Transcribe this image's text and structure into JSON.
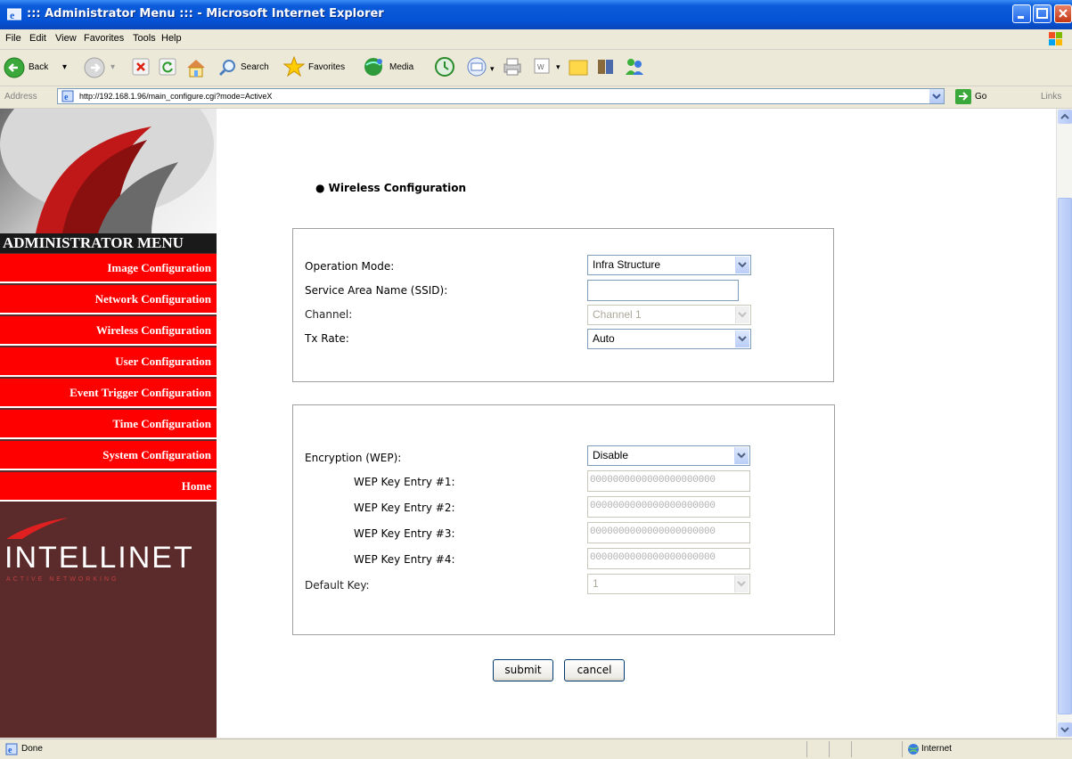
{
  "window": {
    "title": "::: Administrator Menu ::: - Microsoft Internet Explorer",
    "icon": "ie-icon"
  },
  "menubar": {
    "items": [
      "File",
      "Edit",
      "View",
      "Favorites",
      "Tools",
      "Help"
    ]
  },
  "toolbar": {
    "back_label": "Back",
    "search_label": "Search",
    "favorites_label": "Favorites",
    "media_label": "Media"
  },
  "addressbar": {
    "label": "Address",
    "url": "http://192.168.1.96/main_configure.cgi?mode=ActiveX",
    "go_label": "Go",
    "links_label": "Links"
  },
  "sidebar": {
    "header": "ADMINISTRATOR MENU",
    "items": [
      {
        "label": "Image Configuration"
      },
      {
        "label": "Network Configuration"
      },
      {
        "label": "Wireless Configuration"
      },
      {
        "label": "User Configuration"
      },
      {
        "label": "Event Trigger Configuration"
      },
      {
        "label": "Time Configuration"
      },
      {
        "label": "System Configuration"
      },
      {
        "label": "Home"
      }
    ],
    "logo_word": "INTELLINET",
    "logo_tagline": "ACTIVE NETWORKING"
  },
  "main": {
    "section_title": "Wireless Configuration",
    "wireless": {
      "operation_mode_label": "Operation Mode:",
      "operation_mode_value": "Infra Structure",
      "ssid_label": "Service Area Name (SSID):",
      "ssid_value": "",
      "channel_label": "Channel:",
      "channel_value": "Channel 1",
      "tx_rate_label": "Tx Rate:",
      "tx_rate_value": "Auto"
    },
    "encryption": {
      "wep_label": "Encryption (WEP):",
      "wep_value": "Disable",
      "keys": [
        {
          "label": "WEP Key Entry #1:",
          "value": "0000000000000000000000"
        },
        {
          "label": "WEP Key Entry #2:",
          "value": "0000000000000000000000"
        },
        {
          "label": "WEP Key Entry #3:",
          "value": "0000000000000000000000"
        },
        {
          "label": "WEP Key Entry #4:",
          "value": "0000000000000000000000"
        }
      ],
      "default_key_label": "Default Key:",
      "default_key_value": "1"
    },
    "submit_label": "submit",
    "cancel_label": "cancel"
  },
  "statusbar": {
    "status": "Done",
    "zone": "Internet"
  },
  "colors": {
    "title_bar": "#0553d6",
    "sidebar_red": "#ff0000",
    "sidebar_bg": "#5b2b2b"
  }
}
